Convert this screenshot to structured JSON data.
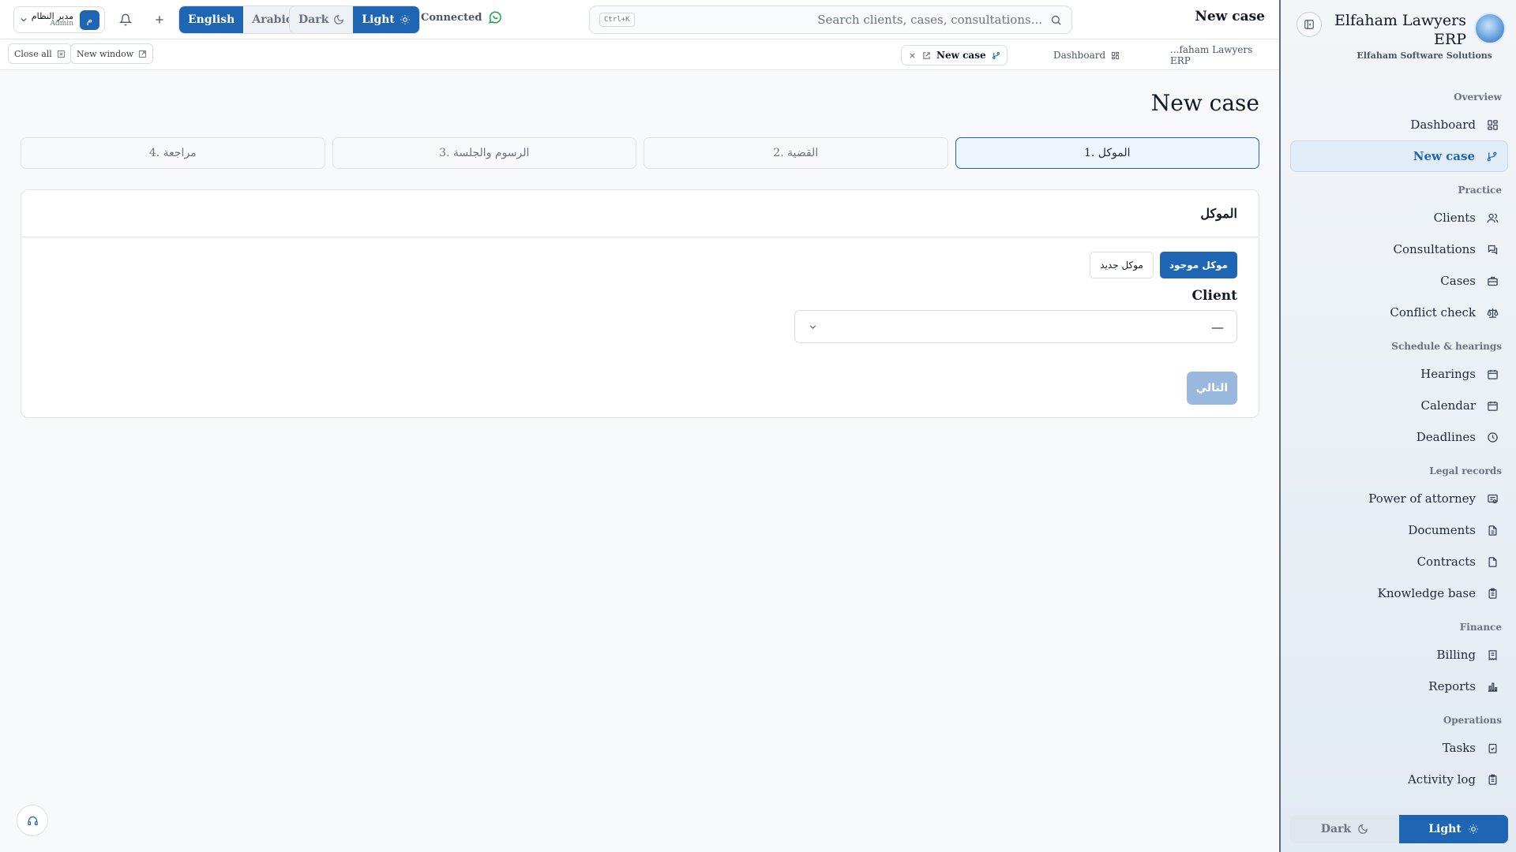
{
  "colors": {
    "accent": "#1e66b3",
    "connected": "#16a34a",
    "disabled_button": "#98b9dd"
  },
  "topbar": {
    "user": {
      "name": "مدير النظام",
      "role": "Admin",
      "initial": "م"
    },
    "language": {
      "options": [
        "English",
        "Arabic"
      ],
      "selected": "English"
    },
    "theme": {
      "dark": "Dark",
      "light": "Light",
      "selected": "Light"
    },
    "status": "Connected",
    "search": {
      "placeholder": "Search clients, cases, consultations...",
      "shortcut": "Ctrl+K"
    },
    "title": "New case"
  },
  "tabsbar": {
    "close_all": "Close all",
    "new_window": "New window",
    "tabs": [
      {
        "label": "New case",
        "active": true
      },
      {
        "label": "Dashboard",
        "active": false
      },
      {
        "label": "...faham Lawyers ERP",
        "active": false
      }
    ]
  },
  "main": {
    "page_title": "New case",
    "steps": [
      {
        "label": "1. الموكل",
        "active": true
      },
      {
        "label": "2. القضية",
        "active": false
      },
      {
        "label": "3. الرسوم والجلسة",
        "active": false
      },
      {
        "label": "4. مراجعة",
        "active": false
      }
    ],
    "card": {
      "title": "الموكل",
      "existing_client": "موكل موجود",
      "new_client": "موكل جديد",
      "client_label": "Client",
      "client_value": "—",
      "next": "التالي"
    }
  },
  "sidebar": {
    "brand": "Elfaham Lawyers ERP",
    "company": "Elfaham Software Solutions",
    "sections": [
      {
        "title": "Overview",
        "items": [
          {
            "label": "Dashboard",
            "icon": "dashboard-icon"
          },
          {
            "label": "New case",
            "icon": "git-branch-icon",
            "active": true
          }
        ]
      },
      {
        "title": "Practice",
        "items": [
          {
            "label": "Clients",
            "icon": "users-icon"
          },
          {
            "label": "Consultations",
            "icon": "chat-icon"
          },
          {
            "label": "Cases",
            "icon": "briefcase-icon"
          },
          {
            "label": "Conflict check",
            "icon": "scale-icon"
          }
        ]
      },
      {
        "title": "Schedule & hearings",
        "items": [
          {
            "label": "Hearings",
            "icon": "calendar-icon"
          },
          {
            "label": "Calendar",
            "icon": "calendar-icon"
          },
          {
            "label": "Deadlines",
            "icon": "clock-icon"
          }
        ]
      },
      {
        "title": "Legal records",
        "items": [
          {
            "label": "Power of attorney",
            "icon": "stamp-icon"
          },
          {
            "label": "Documents",
            "icon": "file-icon"
          },
          {
            "label": "Contracts",
            "icon": "file-icon"
          },
          {
            "label": "Knowledge base",
            "icon": "clipboard-icon"
          }
        ]
      },
      {
        "title": "Finance",
        "items": [
          {
            "label": "Billing",
            "icon": "receipt-icon"
          },
          {
            "label": "Reports",
            "icon": "bar-chart-icon"
          }
        ]
      },
      {
        "title": "Operations",
        "items": [
          {
            "label": "Tasks",
            "icon": "clipboard-check-icon"
          },
          {
            "label": "Activity log",
            "icon": "clipboard-icon"
          }
        ]
      }
    ],
    "theme": {
      "dark": "Dark",
      "light": "Light",
      "selected": "Light"
    }
  }
}
